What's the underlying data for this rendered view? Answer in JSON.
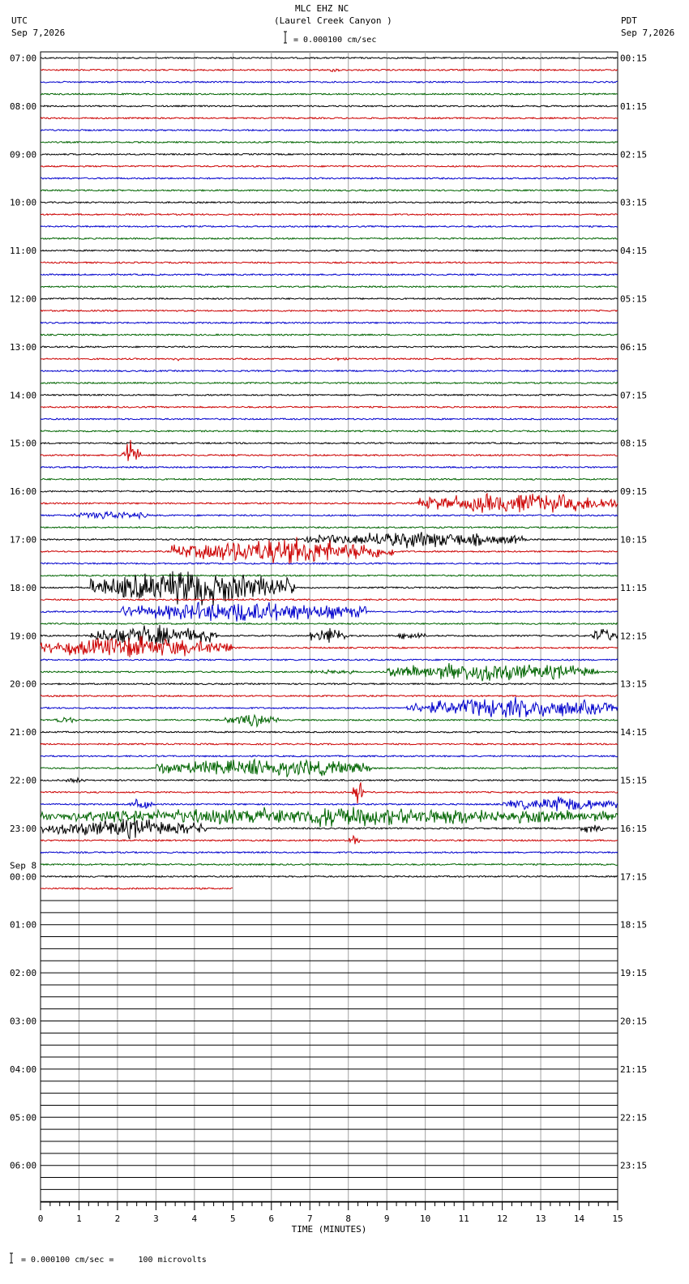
{
  "header": {
    "title": "MLC EHZ NC",
    "subtitle": "(Laurel Creek Canyon )",
    "scale_text": "= 0.000100 cm/sec",
    "left_tz": "UTC",
    "left_date": "Sep 7,2026",
    "right_tz": "PDT",
    "right_date": "Sep 7,2026"
  },
  "footer": {
    "scale_text": "= 0.000100 cm/sec =     100 microvolts"
  },
  "chart_data": {
    "type": "helicorder",
    "xlabel": "TIME (MINUTES)",
    "x_ticks": [
      "0",
      "1",
      "2",
      "3",
      "4",
      "5",
      "6",
      "7",
      "8",
      "9",
      "10",
      "11",
      "12",
      "13",
      "14",
      "15"
    ],
    "xlim": [
      0,
      15
    ],
    "minutes_per_line": 15,
    "line_colors": [
      "#000000",
      "#cc0000",
      "#0000cc",
      "#006400"
    ],
    "date_change_label": "Sep 8",
    "hours": [
      {
        "utc": "07:00",
        "pdt": "00:15"
      },
      {
        "utc": "08:00",
        "pdt": "01:15"
      },
      {
        "utc": "09:00",
        "pdt": "02:15"
      },
      {
        "utc": "10:00",
        "pdt": "03:15"
      },
      {
        "utc": "11:00",
        "pdt": "04:15"
      },
      {
        "utc": "12:00",
        "pdt": "05:15"
      },
      {
        "utc": "13:00",
        "pdt": "06:15"
      },
      {
        "utc": "14:00",
        "pdt": "07:15"
      },
      {
        "utc": "15:00",
        "pdt": "08:15"
      },
      {
        "utc": "16:00",
        "pdt": "09:15"
      },
      {
        "utc": "17:00",
        "pdt": "10:15"
      },
      {
        "utc": "18:00",
        "pdt": "11:15"
      },
      {
        "utc": "19:00",
        "pdt": "12:15"
      },
      {
        "utc": "20:00",
        "pdt": "13:15"
      },
      {
        "utc": "21:00",
        "pdt": "14:15"
      },
      {
        "utc": "22:00",
        "pdt": "15:15"
      },
      {
        "utc": "23:00",
        "pdt": "16:15"
      },
      {
        "utc": "00:00",
        "pdt": "17:15"
      },
      {
        "utc": "01:00",
        "pdt": "18:15"
      },
      {
        "utc": "02:00",
        "pdt": "19:15"
      },
      {
        "utc": "03:00",
        "pdt": "20:15"
      },
      {
        "utc": "04:00",
        "pdt": "21:15"
      },
      {
        "utc": "05:00",
        "pdt": "22:15"
      },
      {
        "utc": "06:00",
        "pdt": "23:15"
      }
    ],
    "recorded_traces": 70,
    "last_trace_end_minute": 5,
    "events": [
      {
        "trace": 1,
        "start": 7.5,
        "end": 7.8,
        "amplitude": 0.4
      },
      {
        "trace": 25,
        "start": 3.4,
        "end": 3.7,
        "amplitude": 0.4
      },
      {
        "trace": 25,
        "start": 7.4,
        "end": 8.0,
        "amplitude": 0.3
      },
      {
        "trace": 33,
        "start": 2.1,
        "end": 2.6,
        "amplitude": 2.4
      },
      {
        "trace": 37,
        "start": 9.8,
        "end": 15.0,
        "amplitude": 1.8
      },
      {
        "trace": 38,
        "start": 0.8,
        "end": 2.8,
        "amplitude": 0.8
      },
      {
        "trace": 40,
        "start": 6.8,
        "end": 12.6,
        "amplitude": 1.4
      },
      {
        "trace": 41,
        "start": 3.4,
        "end": 9.2,
        "amplitude": 2.2
      },
      {
        "trace": 44,
        "start": 1.3,
        "end": 6.6,
        "amplitude": 3.0
      },
      {
        "trace": 46,
        "start": 2.1,
        "end": 8.5,
        "amplitude": 1.8
      },
      {
        "trace": 48,
        "start": 1.3,
        "end": 4.6,
        "amplitude": 1.8
      },
      {
        "trace": 48,
        "start": 7.0,
        "end": 8.0,
        "amplitude": 1.6
      },
      {
        "trace": 48,
        "start": 9.3,
        "end": 10.0,
        "amplitude": 0.8
      },
      {
        "trace": 48,
        "start": 14.3,
        "end": 15.0,
        "amplitude": 1.2
      },
      {
        "trace": 49,
        "start": 0.0,
        "end": 5.0,
        "amplitude": 1.8
      },
      {
        "trace": 51,
        "start": 7.0,
        "end": 8.2,
        "amplitude": 0.5
      },
      {
        "trace": 51,
        "start": 9.0,
        "end": 14.5,
        "amplitude": 1.6
      },
      {
        "trace": 54,
        "start": 9.5,
        "end": 15.0,
        "amplitude": 1.8
      },
      {
        "trace": 55,
        "start": 0.3,
        "end": 1.0,
        "amplitude": 0.6
      },
      {
        "trace": 55,
        "start": 4.8,
        "end": 6.2,
        "amplitude": 1.1
      },
      {
        "trace": 59,
        "start": 3.0,
        "end": 8.6,
        "amplitude": 1.6
      },
      {
        "trace": 60,
        "start": 0.6,
        "end": 1.2,
        "amplitude": 0.5
      },
      {
        "trace": 61,
        "start": 8.1,
        "end": 8.4,
        "amplitude": 2.2
      },
      {
        "trace": 62,
        "start": 2.3,
        "end": 2.9,
        "amplitude": 1.0
      },
      {
        "trace": 62,
        "start": 12.0,
        "end": 15.0,
        "amplitude": 1.2
      },
      {
        "trace": 63,
        "start": 0.0,
        "end": 15.0,
        "amplitude": 1.6
      },
      {
        "trace": 64,
        "start": 0.0,
        "end": 4.3,
        "amplitude": 1.6
      },
      {
        "trace": 64,
        "start": 14.0,
        "end": 14.6,
        "amplitude": 0.8
      },
      {
        "trace": 65,
        "start": 8.0,
        "end": 8.3,
        "amplitude": 1.3
      }
    ]
  }
}
